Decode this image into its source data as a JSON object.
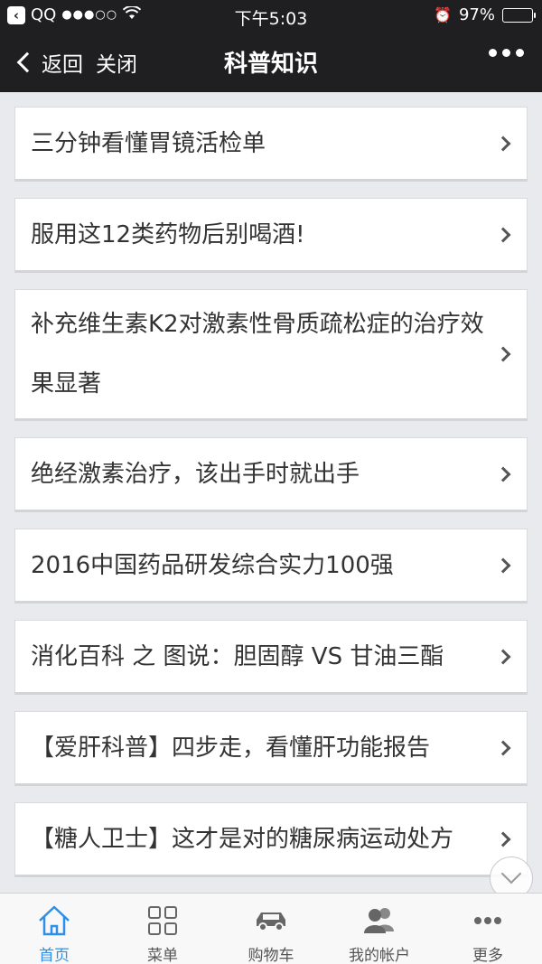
{
  "status_bar": {
    "back_app": "QQ",
    "signal": "●●●○○",
    "time": "下午5:03",
    "battery": "97%",
    "battery_level": 0.97
  },
  "nav": {
    "back_label": "返回",
    "close_label": "关闭",
    "title": "科普知识"
  },
  "articles": [
    "三分钟看懂胃镜活检单",
    "服用这12类药物后别喝酒!",
    "补充维生素K2对激素性骨质疏松症的治疗效果显著",
    "绝经激素治疗，该出手时就出手",
    "2016中国药品研发综合实力100强",
    "消化百科 之 图说：胆固醇 VS 甘油三酯",
    "【爱肝科普】四步走，看懂肝功能报告",
    "【糖人卫士】这才是对的糖尿病运动处方"
  ],
  "tabs": [
    {
      "label": "首页",
      "icon": "home-icon",
      "active": true
    },
    {
      "label": "菜单",
      "icon": "grid-icon",
      "active": false
    },
    {
      "label": "购物车",
      "icon": "car-icon",
      "active": false
    },
    {
      "label": "我的帐户",
      "icon": "users-icon",
      "active": false
    },
    {
      "label": "更多",
      "icon": "more-icon",
      "active": false
    }
  ],
  "colors": {
    "accent": "#2f8fe8",
    "header_bg": "#1f1f21",
    "page_bg": "#e9eaee"
  }
}
